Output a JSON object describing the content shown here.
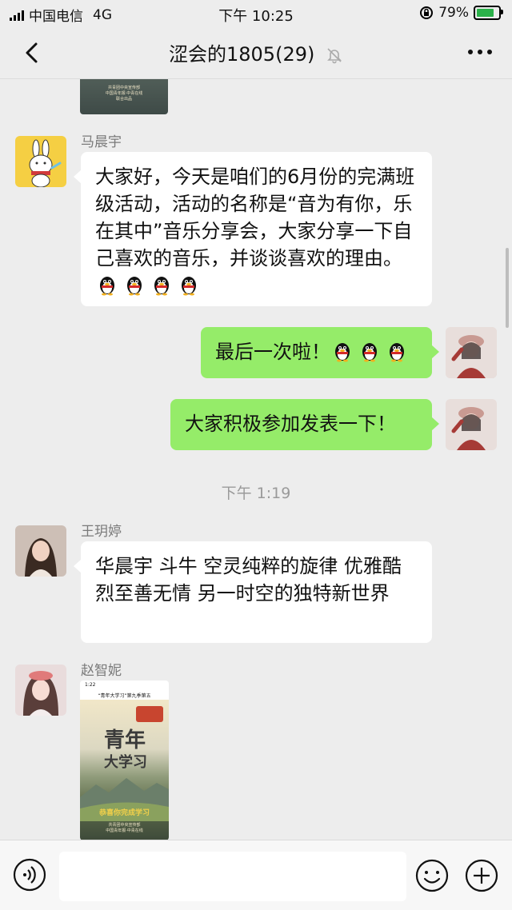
{
  "status_bar": {
    "carrier": "中国电信",
    "network": "4G",
    "time": "下午 10:25",
    "battery": "79%",
    "battery_level": 0.79
  },
  "header": {
    "title": "涩会的1805(29)",
    "back_icon": "chevron-left-icon",
    "mute_icon": "bell-off-icon",
    "more_icon": "more-dots-icon"
  },
  "messages": [
    {
      "type": "image",
      "side": "left",
      "image_lines": [
        "共青团中央宣传部",
        "中国青年报·中青在线",
        "联合出品"
      ]
    },
    {
      "type": "text",
      "side": "left",
      "sender": "马晨宇",
      "text": "大家好，今天是咱们的6月份的完满班级活动，活动的名称是“音为有你，乐在其中”音乐分享会，大家分享一下自己喜欢的音乐，并谈谈喜欢的理由。",
      "emoji_count": 4
    },
    {
      "type": "text",
      "side": "right",
      "text": "最后一次啦！",
      "emoji_count": 3
    },
    {
      "type": "text",
      "side": "right",
      "text": "大家积极参加发表一下！",
      "emoji_count": 0
    },
    {
      "type": "time",
      "text": "下午 1:19"
    },
    {
      "type": "text",
      "side": "left",
      "sender": "王玥婷",
      "text": "华晨宇 斗牛 空灵纯粹的旋律 优雅酷烈至善无情 另一时空的独特新世界",
      "emoji_count": 0
    },
    {
      "type": "image",
      "side": "left",
      "sender": "赵智妮",
      "image_time": "1:22",
      "image_header": "“青年大学习”第九季第五",
      "image_title_1": "青年",
      "image_title_2": "大学习",
      "image_slogan": "恭喜你完成学习",
      "image_lines": [
        "共青团中央宣传部",
        "中国青年报·中青在线",
        "联合出品"
      ]
    }
  ],
  "input_bar": {
    "voice_icon": "voice-icon",
    "emoji_icon": "smiley-icon",
    "plus_icon": "plus-icon",
    "input_value": ""
  },
  "colors": {
    "background": "#ededed",
    "bubble_mine": "#95ec69",
    "bubble_other": "#ffffff",
    "emoji_panel_button": "#000000"
  }
}
